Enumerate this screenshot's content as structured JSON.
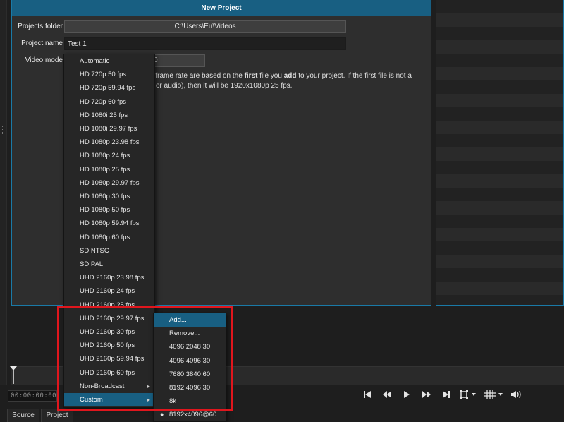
{
  "dialog": {
    "title": "New Project",
    "projects_folder_label": "Projects folder",
    "projects_folder_value": "C:\\Users\\Eu\\Videos",
    "project_name_label": "Project name",
    "project_name_value": "Test 1",
    "video_mode_label": "Video mode",
    "video_mode_value_fragment": "0",
    "description_line1_a": "on and frame rate are based on the ",
    "description_line1_b": "first",
    "description_line1_c": " file you ",
    "description_line1_d": "add",
    "description_line1_e": " to your project. If the first file is not a",
    "description_line2": " or audio), then it will be 1920x1080p 25 fps."
  },
  "video_mode_menu": {
    "items": [
      "Automatic",
      "HD 720p 50 fps",
      "HD 720p 59.94 fps",
      "HD 720p 60 fps",
      "HD 1080i 25 fps",
      "HD 1080i 29.97 fps",
      "HD 1080p 23.98 fps",
      "HD 1080p 24 fps",
      "HD 1080p 25 fps",
      "HD 1080p 29.97 fps",
      "HD 1080p 30 fps",
      "HD 1080p 50 fps",
      "HD 1080p 59.94 fps",
      "HD 1080p 60 fps",
      "SD NTSC",
      "SD PAL",
      "UHD 2160p 23.98 fps",
      "UHD 2160p 24 fps",
      "UHD 2160p 25 fps",
      "UHD 2160p 29.97 fps",
      "UHD 2160p 30 fps",
      "UHD 2160p 50 fps",
      "UHD 2160p 59.94 fps",
      "UHD 2160p 60 fps",
      "Non-Broadcast",
      "Custom"
    ],
    "submenu_arrow": "▸"
  },
  "custom_submenu": {
    "items": [
      "Add...",
      "Remove...",
      "4096 2048 30",
      "4096 4096 30",
      "7680 3840 60",
      "8192 4096 30",
      "8k",
      "8192x4096@60"
    ],
    "selected_bullet": "●"
  },
  "player": {
    "timecode": "00:00:00:00"
  },
  "tabs": {
    "source": "Source",
    "project": "Project"
  },
  "colors": {
    "accent": "#185f82",
    "annotation_red": "#e0161d",
    "background": "#1e1e1e"
  },
  "icons": [
    "skip-previous-icon",
    "rewind-icon",
    "play-icon",
    "fast-forward-icon",
    "skip-next-icon",
    "zoom-fit-icon",
    "grid-icon",
    "volume-icon"
  ]
}
